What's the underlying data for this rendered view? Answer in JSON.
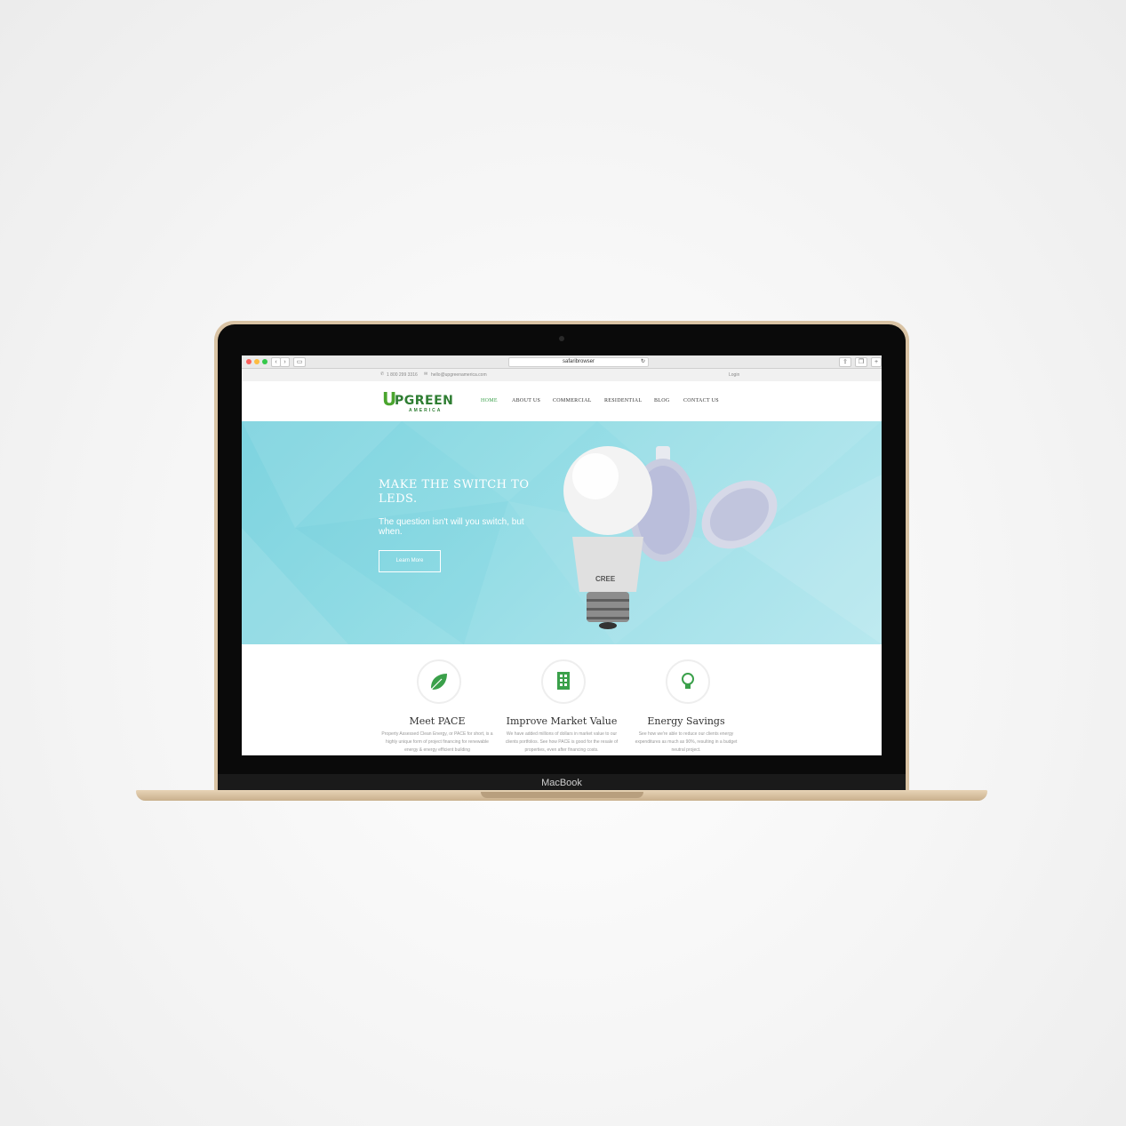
{
  "device": {
    "label": "MacBook"
  },
  "browser": {
    "url": "safaribrowser",
    "back_icon": "chevron-left-icon",
    "forward_icon": "chevron-right-icon"
  },
  "site": {
    "topbar": {
      "phone": "1 800 299 3316",
      "email": "hello@upgreenamerica.com",
      "login": "Login"
    },
    "logo": {
      "first_letter": "U",
      "rest": "PGREEN",
      "sub": "AMERICA"
    },
    "nav": [
      {
        "label": "HOME",
        "active": true
      },
      {
        "label": "ABOUT US"
      },
      {
        "label": "COMMERCIAL"
      },
      {
        "label": "RESIDENTIAL"
      },
      {
        "label": "BLOG"
      },
      {
        "label": "CONTACT US"
      }
    ],
    "hero": {
      "title": "MAKE THE SWITCH TO LEDS.",
      "subtitle": "The question isn't will you switch, but when.",
      "button": "Learn More",
      "bulb_brand": "CREE"
    },
    "features": [
      {
        "icon": "leaf-icon",
        "title": "Meet PACE",
        "desc": "Property Assessed Clean Energy, or PACE for short, is a highly unique form of project financing for renewable energy & energy efficient building"
      },
      {
        "icon": "building-icon",
        "title": "Improve Market Value",
        "desc": "We have added millions of dollars in market value to our clients portfolios. See how PACE is good for the resale of properties, even after financing costs."
      },
      {
        "icon": "lightbulb-icon",
        "title": "Energy Savings",
        "desc": "See how we're able to reduce our clients energy expenditures as much as 90%, resulting in a budget neutral project."
      }
    ]
  },
  "colors": {
    "brand_green": "#2e7d32",
    "nav_active": "#3aa04a",
    "hero_teal": "#8fdbe4"
  }
}
